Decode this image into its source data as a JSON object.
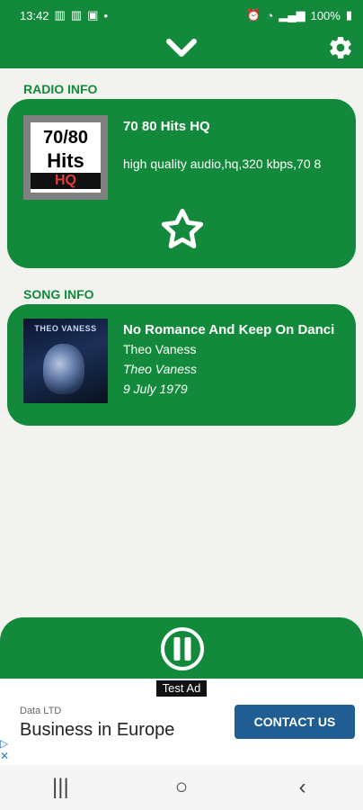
{
  "status": {
    "time": "13:42",
    "left_icons": [
      "notification-icon",
      "sim-icon",
      "sim-icon",
      "image-icon",
      "dot-icon"
    ],
    "battery": "100%",
    "right_icons": [
      "alarm-icon",
      "wifi-icon",
      "signal-icon",
      "battery-icon"
    ]
  },
  "header": {
    "collapse_icon": "chevron-down-icon",
    "settings_icon": "gear-icon",
    "color": "#138a3b"
  },
  "radio_info": {
    "section_title": "RADIO INFO",
    "logo": {
      "line1": "70/80",
      "line2": "Hits",
      "line3": "HQ"
    },
    "title": "70 80 Hits HQ",
    "description": "high quality audio,hq,320 kbps,70 8"
  },
  "song_info": {
    "section_title": "SONG INFO",
    "album_art": {
      "title": "THEO VANESS",
      "subtitle": ""
    },
    "title": "No Romance And Keep On Danci",
    "artist": "Theo Vaness",
    "album": "Theo Vaness",
    "date": "9 July 1979"
  },
  "player": {
    "pause_icon": "pause-icon"
  },
  "ad": {
    "label": "Test Ad",
    "company": "Data LTD",
    "headline": "Business in Europe",
    "cta": "CONTACT US"
  },
  "navigation": {
    "recent": "|||",
    "home": "○",
    "back": "‹"
  },
  "colors": {
    "primary": "#138a3b",
    "background": "#f2f2ee",
    "ad_cta": "#1f5d93"
  }
}
